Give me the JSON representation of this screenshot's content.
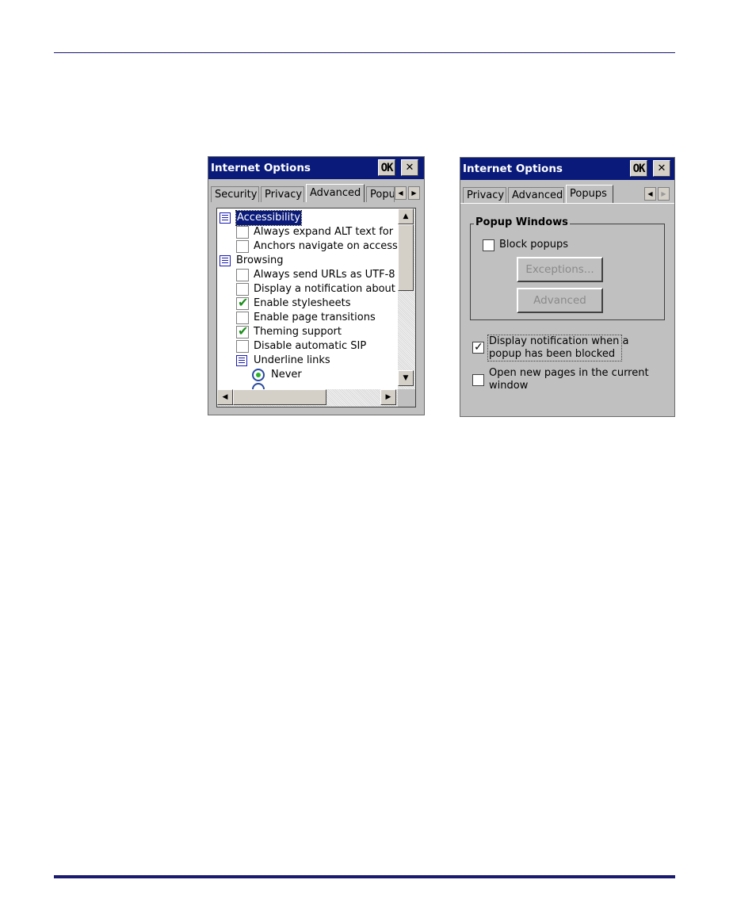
{
  "left_window": {
    "title": "Internet Options",
    "ok_label": "OK",
    "close_label": "✕",
    "tabs": [
      "Security",
      "Privacy",
      "Advanced",
      "Popu"
    ],
    "items": [
      {
        "type": "category",
        "label": "Accessibility"
      },
      {
        "type": "checkbox",
        "label": "Always expand ALT text for",
        "checked": false
      },
      {
        "type": "checkbox",
        "label": "Anchors navigate on access l",
        "checked": false
      },
      {
        "type": "category",
        "label": "Browsing"
      },
      {
        "type": "checkbox",
        "label": "Always send URLs as UTF-8",
        "checked": false
      },
      {
        "type": "checkbox",
        "label": "Display a notification about e",
        "checked": false
      },
      {
        "type": "checkbox",
        "label": "Enable stylesheets",
        "checked": true
      },
      {
        "type": "checkbox",
        "label": "Enable page transitions",
        "checked": false
      },
      {
        "type": "checkbox",
        "label": "Theming support",
        "checked": true
      },
      {
        "type": "checkbox",
        "label": "Disable automatic SIP",
        "checked": false
      },
      {
        "type": "subcategory",
        "label": "Underline links"
      },
      {
        "type": "radio",
        "label": "Never",
        "selected": true
      }
    ]
  },
  "right_window": {
    "title": "Internet Options",
    "ok_label": "OK",
    "close_label": "✕",
    "tabs": [
      "Privacy",
      "Advanced",
      "Popups"
    ],
    "group_title": "Popup Windows",
    "block_popups_label": "Block popups",
    "block_popups_checked": false,
    "exceptions_label": "Exceptions...",
    "advanced_label": "Advanced",
    "notify_line1": "Display notification when a",
    "notify_line2": "popup has been blocked",
    "notify_checked": true,
    "open_line1": "Open new pages in the current",
    "open_line2": "window",
    "open_checked": false
  }
}
